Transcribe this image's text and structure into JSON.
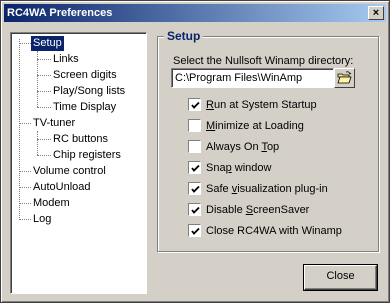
{
  "window": {
    "title": "RC4WA Preferences",
    "close_glyph": "×"
  },
  "tree": {
    "items": [
      {
        "label": "Setup",
        "selected": true
      },
      {
        "label": "Links"
      },
      {
        "label": "Screen digits"
      },
      {
        "label": "Play/Song lists"
      },
      {
        "label": "Time Display"
      },
      {
        "label": "TV-tuner"
      },
      {
        "label": "RC buttons"
      },
      {
        "label": "Chip registers"
      },
      {
        "label": "Volume control"
      },
      {
        "label": "AutoUnload"
      },
      {
        "label": "Modem"
      },
      {
        "label": "Log"
      }
    ]
  },
  "setup": {
    "title": "Setup",
    "dir_label": "Select the Nullsoft Winamp directory:",
    "dir_value": "C:\\Program Files\\WinAmp",
    "browse_icon": "folder-open-icon",
    "options": [
      {
        "pre": "",
        "u": "R",
        "post": "un at System Startup",
        "checked": true
      },
      {
        "pre": "",
        "u": "M",
        "post": "inimize at Loading",
        "checked": false
      },
      {
        "pre": "Always On ",
        "u": "T",
        "post": "op",
        "checked": false
      },
      {
        "pre": "Sna",
        "u": "p",
        "post": " window",
        "checked": true
      },
      {
        "pre": "Safe ",
        "u": "v",
        "post": "isualization plug-in",
        "checked": true
      },
      {
        "pre": "Disable ",
        "u": "S",
        "post": "creenSaver",
        "checked": true
      },
      {
        "pre": "Close RC4WA with Winamp",
        "u": "",
        "post": "",
        "checked": true
      }
    ]
  },
  "buttons": {
    "close": "Close"
  },
  "colors": {
    "selection": "#0a246a",
    "face": "#d4d0c8",
    "accent_text": "#0a246a"
  }
}
